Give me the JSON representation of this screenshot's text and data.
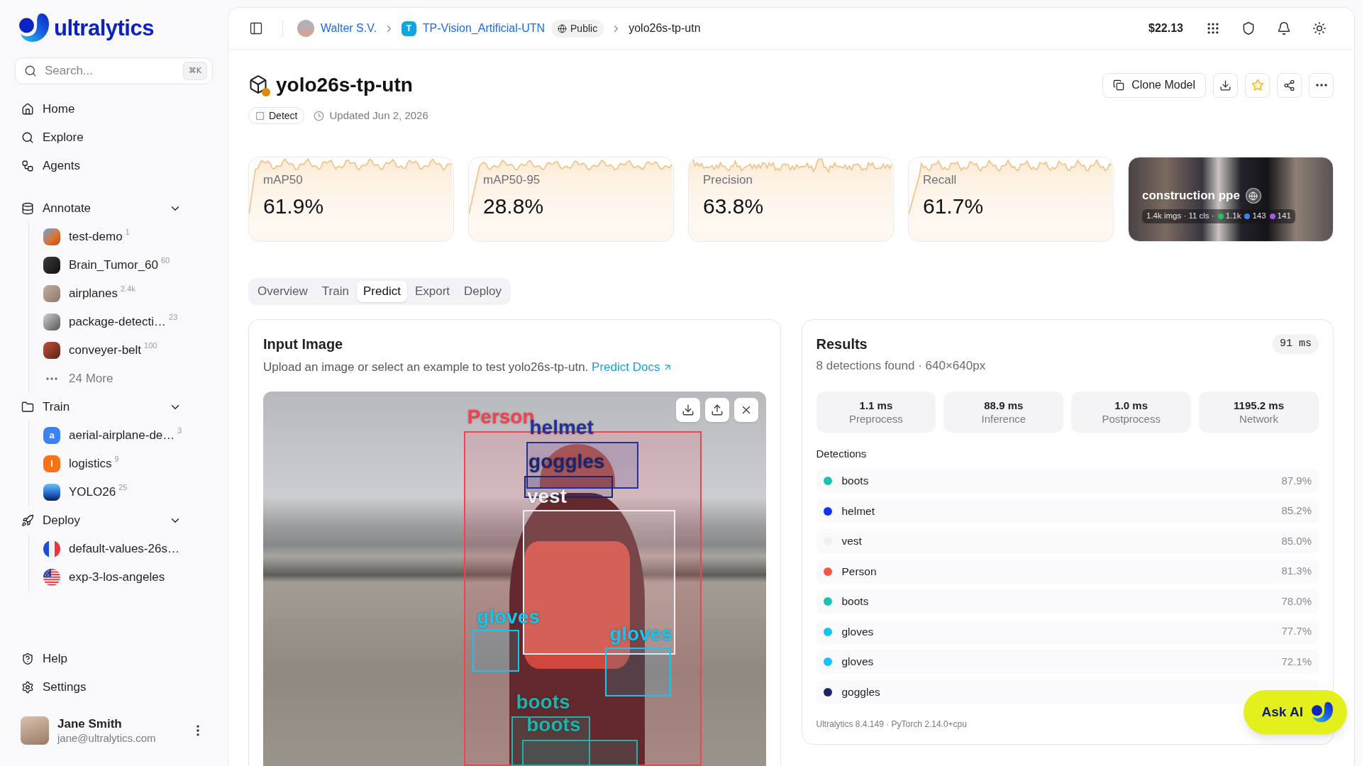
{
  "sidebar": {
    "logo": "ultralytics",
    "search": {
      "placeholder": "Search...",
      "shortcut": "⌘K"
    },
    "nav": [
      {
        "label": "Home"
      },
      {
        "label": "Explore"
      },
      {
        "label": "Agents"
      }
    ],
    "sections": [
      {
        "label": "Annotate",
        "expanded": true,
        "items": [
          {
            "kind": "photo",
            "name": "test-demo",
            "count": "1"
          },
          {
            "kind": "photo",
            "name": "Brain_Tumor_60",
            "count": "60"
          },
          {
            "kind": "photo",
            "name": "airplanes",
            "count": "2.4k"
          },
          {
            "kind": "photo",
            "name": "package-detecti…",
            "count": "23"
          },
          {
            "kind": "photo",
            "name": "conveyer-belt",
            "count": "100"
          },
          {
            "kind": "more",
            "name": "24 More"
          }
        ]
      },
      {
        "label": "Train",
        "expanded": true,
        "items": [
          {
            "kind": "letter",
            "letter": "a",
            "color": "#3b82f6",
            "name": "aerial-airplane-de…",
            "count": "3"
          },
          {
            "kind": "letter",
            "letter": "l",
            "color": "#f97316",
            "name": "logistics",
            "count": "9"
          },
          {
            "kind": "gradient",
            "name": "YOLO26",
            "count": "25"
          }
        ]
      },
      {
        "label": "Deploy",
        "expanded": true,
        "items": [
          {
            "kind": "flag",
            "name": "default-values-26s…"
          },
          {
            "kind": "flag",
            "name": "exp-3-los-angeles"
          }
        ]
      }
    ],
    "footer": [
      {
        "label": "Help"
      },
      {
        "label": "Settings"
      }
    ],
    "user": {
      "name": "Jane Smith",
      "email": "jane@ultralytics.com"
    }
  },
  "header": {
    "breadcrumb": {
      "owner": "Walter S.V.",
      "project_initial": "T",
      "project": "TP-Vision_Artificial-UTN",
      "visibility": "Public",
      "model": "yolo26s-tp-utn"
    },
    "balance": "$22.13"
  },
  "model": {
    "title": "yolo26s-tp-utn",
    "task": "Detect",
    "updated": "Updated Jun 2, 2026",
    "clone_label": "Clone Model",
    "starred": true
  },
  "metrics": [
    {
      "label": "mAP50",
      "value": "61.9%"
    },
    {
      "label": "mAP50-95",
      "value": "28.8%"
    },
    {
      "label": "Precision",
      "value": "63.8%"
    },
    {
      "label": "Recall",
      "value": "61.7%"
    }
  ],
  "dataset": {
    "name": "construction ppe",
    "summary": "1.4k imgs · 11 cls ·",
    "class_counts": [
      {
        "color": "#22c55e",
        "count": "1.1k"
      },
      {
        "color": "#3b82f6",
        "count": "143"
      },
      {
        "color": "#a855f7",
        "count": "141"
      }
    ]
  },
  "tabs": [
    {
      "label": "Overview",
      "selected": false
    },
    {
      "label": "Train",
      "selected": false
    },
    {
      "label": "Predict",
      "selected": true
    },
    {
      "label": "Export",
      "selected": false
    },
    {
      "label": "Deploy",
      "selected": false
    }
  ],
  "input": {
    "title": "Input Image",
    "description": "Upload an image or select an example to test yolo26s-tp-utn.",
    "docs_link": "Predict Docs",
    "overlays": [
      {
        "label": "Person",
        "color": "#f0434f"
      },
      {
        "label": "helmet",
        "color": "#25309a"
      },
      {
        "label": "goggles",
        "color": "#1b2470"
      },
      {
        "label": "vest",
        "color": "#f1eff2"
      },
      {
        "label": "gloves",
        "color": "#17c5ec"
      },
      {
        "label": "gloves",
        "color": "#17c5ec"
      },
      {
        "label": "boots",
        "color": "#1eb2ac"
      },
      {
        "label": "boots",
        "color": "#1eb2ac"
      }
    ]
  },
  "results": {
    "title": "Results",
    "latency": "91 ms",
    "summary": "8 detections found · 640×640px",
    "timings": [
      {
        "value": "1.1 ms",
        "label": "Preprocess"
      },
      {
        "value": "88.9 ms",
        "label": "Inference"
      },
      {
        "value": "1.0 ms",
        "label": "Postprocess"
      },
      {
        "value": "1195.2 ms",
        "label": "Network"
      }
    ],
    "detections_label": "Detections",
    "detections": [
      {
        "name": "boots",
        "color": "#18c3b1",
        "confidence": "87.9%"
      },
      {
        "name": "helmet",
        "color": "#0b33fa",
        "confidence": "85.2%"
      },
      {
        "name": "vest",
        "color": "#efeef3",
        "confidence": "85.0%"
      },
      {
        "name": "Person",
        "color": "#fb5546",
        "confidence": "81.3%"
      },
      {
        "name": "boots",
        "color": "#18c3b1",
        "confidence": "78.0%"
      },
      {
        "name": "gloves",
        "color": "#14c5f2",
        "confidence": "77.7%"
      },
      {
        "name": "gloves",
        "color": "#14c5f2",
        "confidence": "72.1%"
      },
      {
        "name": "goggles",
        "color": "#182569"
      }
    ],
    "footer": "Ultralytics 8.4.149 · PyTorch 2.14.0+cpu"
  },
  "ask_ai": {
    "label": "Ask AI"
  }
}
